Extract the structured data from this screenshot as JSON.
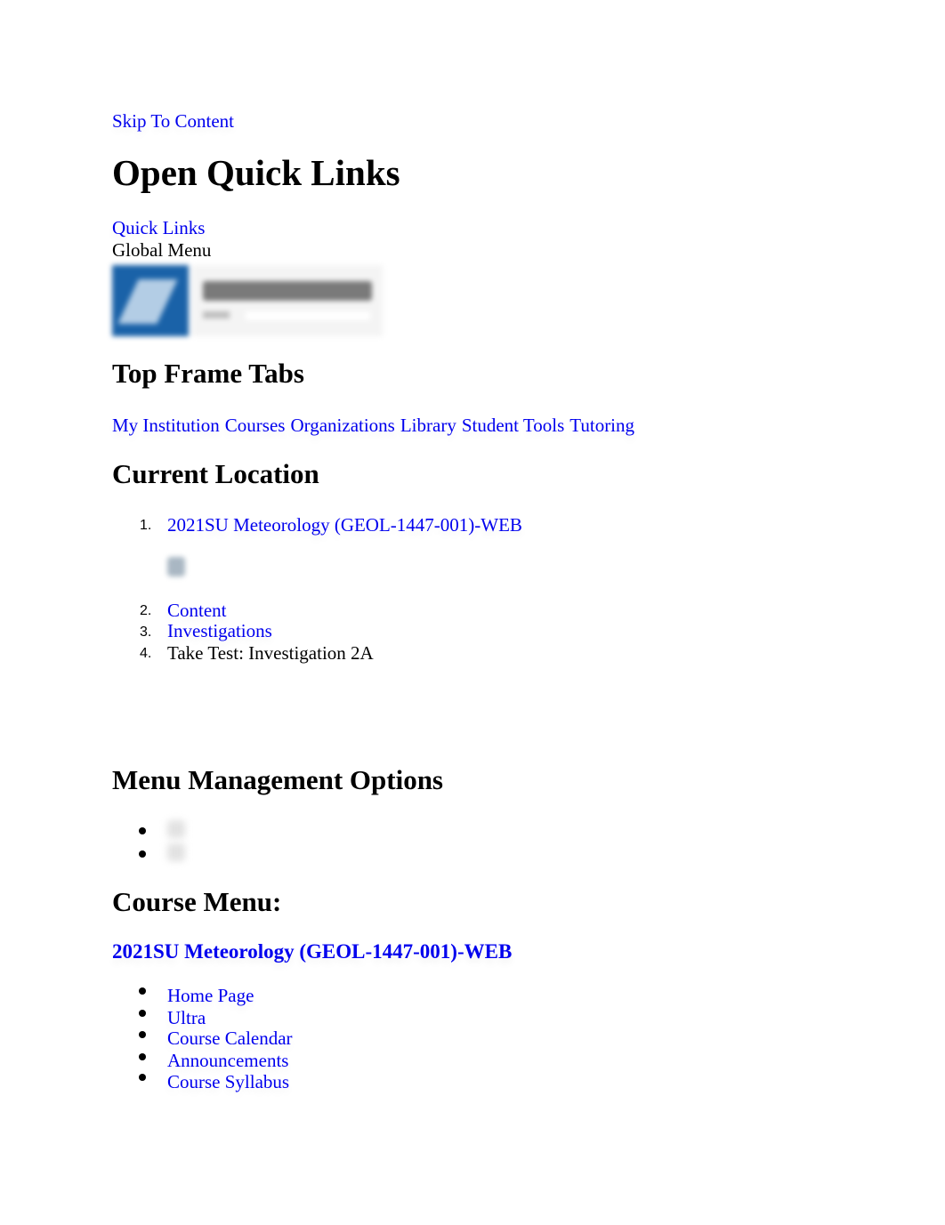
{
  "skip_link": "Skip To Content",
  "quick_links": {
    "heading": "Open Quick Links",
    "link": "Quick Links"
  },
  "global_menu": {
    "label": "Global Menu",
    "logo_icon": "blackboard-logo"
  },
  "top_frame_tabs": {
    "heading": "Top Frame Tabs",
    "tabs": [
      "My Institution",
      "Courses",
      "Organizations",
      "Library",
      "Student Tools",
      "Tutoring"
    ]
  },
  "current_location": {
    "heading": "Current Location",
    "items": [
      {
        "num": "1.",
        "label": "2021SU Meteorology (GEOL-1447-001)-WEB"
      },
      {
        "num": "2.",
        "label": "Content"
      },
      {
        "num": "3.",
        "label": "Investigations"
      },
      {
        "num": "4.",
        "label": "Take Test: Investigation 2A"
      }
    ]
  },
  "menu_management": {
    "heading": "Menu Management Options"
  },
  "course_menu": {
    "heading": "Course Menu:",
    "course_title": "2021SU Meteorology (GEOL-1447-001)-WEB",
    "items": [
      "Home Page",
      "Ultra",
      "Course Calendar",
      "Announcements",
      "Course Syllabus"
    ]
  }
}
